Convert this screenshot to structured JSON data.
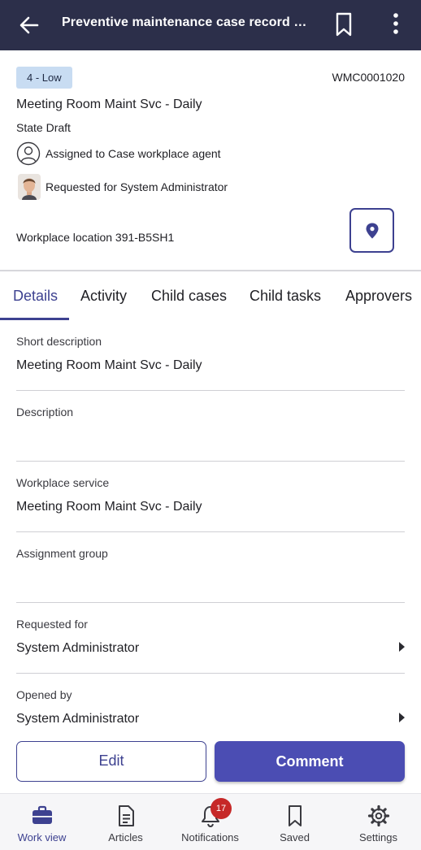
{
  "app_bar": {
    "title": "Preventive maintenance case record scre...",
    "icons": [
      "back-arrow-icon",
      "bookmark-icon",
      "more-vertical-icon"
    ]
  },
  "record": {
    "priority": "4 - Low",
    "number": "WMC0001020",
    "title": "Meeting Room Maint Svc - Daily",
    "state": "State Draft",
    "assigned_to": "Assigned to Case workplace  agent",
    "requested_for": "Requested for System Administrator",
    "workplace_location": "Workplace location 391-B5SH1"
  },
  "tabs": [
    {
      "label": "Details",
      "active": true
    },
    {
      "label": "Activity",
      "active": false
    },
    {
      "label": "Child cases",
      "active": false
    },
    {
      "label": "Child tasks",
      "active": false
    },
    {
      "label": "Approvers",
      "active": false
    }
  ],
  "fields": [
    {
      "label": "Short description",
      "value": "Meeting Room Maint Svc - Daily",
      "has_chevron": false
    },
    {
      "label": "Description",
      "value": "",
      "has_chevron": false
    },
    {
      "label": "Workplace service",
      "value": "Meeting Room Maint Svc - Daily",
      "has_chevron": false
    },
    {
      "label": "Assignment group",
      "value": "",
      "has_chevron": false
    },
    {
      "label": "Requested for",
      "value": "System Administrator",
      "has_chevron": true
    },
    {
      "label": "Opened by",
      "value": "System Administrator",
      "has_chevron": true
    }
  ],
  "actions": {
    "edit_label": "Edit",
    "comment_label": "Comment"
  },
  "bottom_nav": {
    "items": [
      {
        "label": "Work view",
        "icon": "briefcase-icon",
        "active": true
      },
      {
        "label": "Articles",
        "icon": "document-icon",
        "active": false
      },
      {
        "label": "Notifications",
        "icon": "bell-icon",
        "active": false
      },
      {
        "label": "Saved",
        "icon": "bookmark-icon",
        "active": false
      },
      {
        "label": "Settings",
        "icon": "gear-icon",
        "active": false
      }
    ],
    "notifications_badge": "17"
  },
  "colors": {
    "app_bar": "#2c2f4a",
    "accent": "#3d4190",
    "primary_button": "#4b4db3",
    "priority_badge": "#c8dcf2",
    "notification_badge": "#c62828"
  }
}
